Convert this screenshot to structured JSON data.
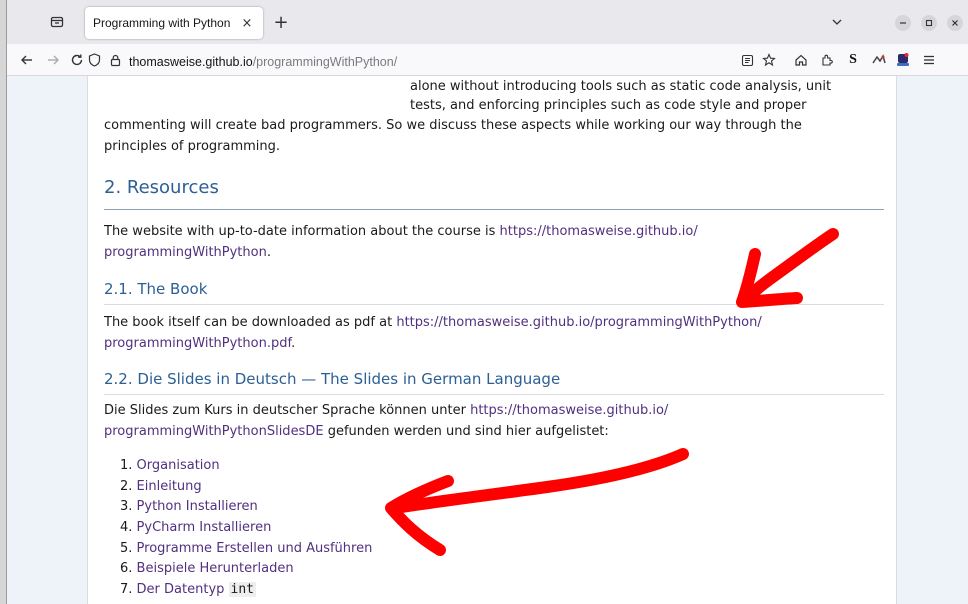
{
  "browser": {
    "tab_title": "Programming with Python",
    "tab_close": "×",
    "new_tab": "+",
    "url_host": "thomasweise.github.io",
    "url_path": "/programmingWithPython/",
    "icons": [
      "tab-list-icon",
      "back-icon",
      "forward-icon",
      "reload-icon",
      "shield-icon",
      "lock-icon",
      "reader-view-icon",
      "bookmark-star-icon",
      "home-icon",
      "extensions-icon",
      "s-extension-icon",
      "extension-icon",
      "profile-extension-icon",
      "menu-icon",
      "minimize-icon",
      "maximize-icon",
      "close-icon"
    ]
  },
  "page": {
    "intro": {
      "line1": "alone without introducing tools such as static code analysis, unit",
      "line2": "tests, and enforcing principles such as code style and proper",
      "line3": "commenting will create bad programmers. So we discuss these aspects while working our way through the",
      "line4": "principles of programming."
    },
    "resources": {
      "heading": "2. Resources",
      "text_before": "The website with up-to-date information about the course is ",
      "link_part1": "https://thomasweise.github.io/",
      "link_part2": "programmingWithPython",
      "text_after": "."
    },
    "book": {
      "heading": "2.1. The Book",
      "text_before": "The book itself can be downloaded as pdf at ",
      "link_part1": "https://thomasweise.github.io/programmingWithPython/",
      "link_part2": "programmingWithPython.pdf",
      "text_after": "."
    },
    "slides": {
      "heading": "2.2. Die Slides in Deutsch — The Slides in German Language",
      "text_before": "Die Slides zum Kurs in deutscher Sprache können unter ",
      "link_part1": "https://thomasweise.github.io/",
      "link_part2": "programmingWithPythonSlidesDE",
      "text_after": " gefunden werden und sind hier aufgelistet:",
      "items": [
        {
          "num": "1.",
          "label": "Organisation"
        },
        {
          "num": "2.",
          "label": "Einleitung"
        },
        {
          "num": "3.",
          "label": "Python Installieren"
        },
        {
          "num": "4.",
          "label": "PyCharm Installieren"
        },
        {
          "num": "5.",
          "label": "Programme Erstellen und Ausführen"
        },
        {
          "num": "6.",
          "label": "Beispiele Herunterladen"
        },
        {
          "num": "7.",
          "label": "Der Datentyp ",
          "code": "int"
        }
      ]
    }
  },
  "colors": {
    "annotation_arrow": "#ff0000",
    "heading": "#2c5f94",
    "link": "#51307f"
  }
}
